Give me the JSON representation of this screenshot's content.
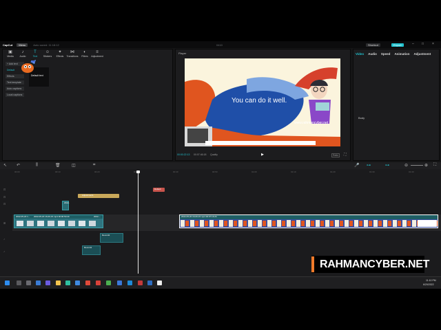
{
  "titlebar": {
    "app": "CapCut",
    "menu": "Menu",
    "saved": "Auto saved: 11:18:12",
    "project": "0410",
    "shortcut": "Shortcut",
    "export": "Export"
  },
  "media": {
    "tabs": [
      "Media",
      "Audio",
      "Text",
      "Stickers",
      "Effects",
      "Transitions",
      "Filters",
      "Adjustment"
    ],
    "left_items": [
      "+ Add text",
      "Default",
      "Effects",
      "Text template",
      "Auto captions",
      "Local captions"
    ],
    "default_text": "Default text"
  },
  "player": {
    "label": "Player",
    "slide_text": "You can do it well.",
    "slide_url": "www.rahmancyber.net",
    "current_time": "00:00:22:13",
    "total_time": "00:07:46:18",
    "quality": "Quality",
    "ratio": "Ratio"
  },
  "props": {
    "tabs": [
      "Video",
      "Audio",
      "Speed",
      "Animation",
      "Adjustment"
    ],
    "body_label": "Body"
  },
  "timeline": {
    "ruler": [
      "00:00",
      "00:10",
      "00:20",
      "00:30",
      "00:40",
      "00:50",
      "01:00",
      "01:10",
      "01:20",
      "01:30",
      "01:40"
    ],
    "default_text_clip": "Default",
    "adjustment_clip": "Adjustment1",
    "main_clip_1": "2022-05-20 1...",
    "main_clip_2": "2022-05-20 16-09-15.mp4  00:00:53:20",
    "main_clip_3": "2022-...",
    "main_clip_long": "2022-05-20 16-09-15.mp4   00:07:16:24",
    "small_clip": "2022-",
    "record1": "Record1",
    "record2": "Record2"
  },
  "taskbar": {
    "time": "11:10 PM",
    "date": "6/20/2022"
  },
  "watermark": {
    "text": "RAHMANCYBER.NET",
    "accent": "#f07a2a"
  }
}
